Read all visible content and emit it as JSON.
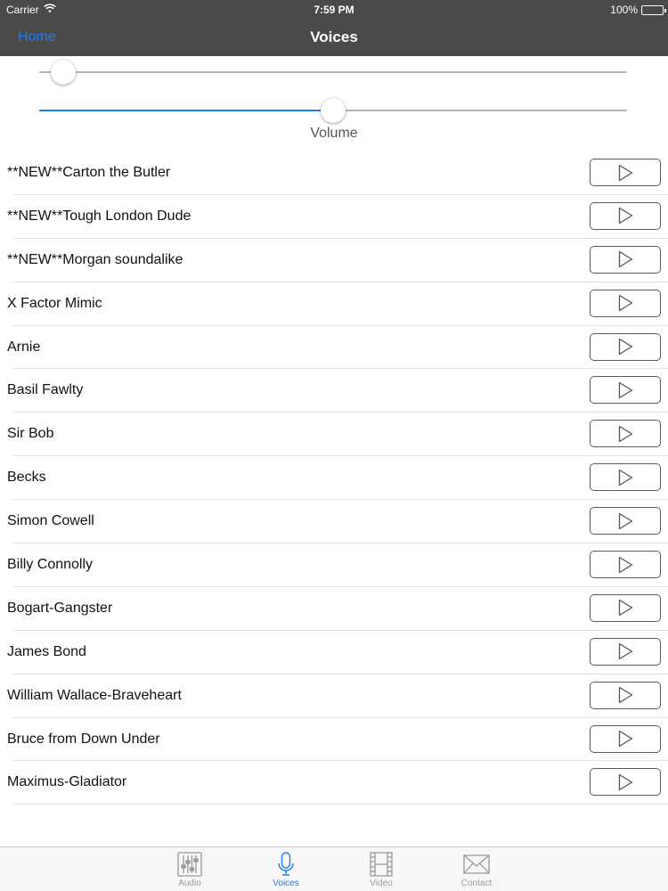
{
  "status_bar": {
    "carrier": "Carrier",
    "time": "7:59 PM",
    "battery": "100%",
    "battery_level": 1.0
  },
  "nav": {
    "back_label": "Home",
    "title": "Voices"
  },
  "sliders": {
    "top_slider_value": 0.02,
    "volume_value": 0.5,
    "volume_label": "Volume"
  },
  "voices": [
    {
      "name": "**NEW**Carton the Butler"
    },
    {
      "name": "**NEW**Tough London Dude"
    },
    {
      "name": "**NEW**Morgan soundalike"
    },
    {
      "name": "X Factor Mimic"
    },
    {
      "name": "Arnie"
    },
    {
      "name": "Basil Fawlty"
    },
    {
      "name": "Sir Bob"
    },
    {
      "name": "Becks"
    },
    {
      "name": "Simon Cowell"
    },
    {
      "name": "Billy Connolly"
    },
    {
      "name": "Bogart-Gangster"
    },
    {
      "name": "James Bond"
    },
    {
      "name": "William Wallace-Braveheart"
    },
    {
      "name": "Bruce from Down Under"
    },
    {
      "name": "Maximus-Gladiator"
    }
  ],
  "tabs": [
    {
      "label": "Audio",
      "icon": "sliders-icon",
      "active": false
    },
    {
      "label": "Voices",
      "icon": "microphone-icon",
      "active": true
    },
    {
      "label": "Video",
      "icon": "film-icon",
      "active": false
    },
    {
      "label": "Contact",
      "icon": "envelope-icon",
      "active": false
    }
  ],
  "colors": {
    "accent": "#1a7ef0",
    "nav_background": "#4a4a4a",
    "inactive_tab": "#9a9a9a"
  }
}
